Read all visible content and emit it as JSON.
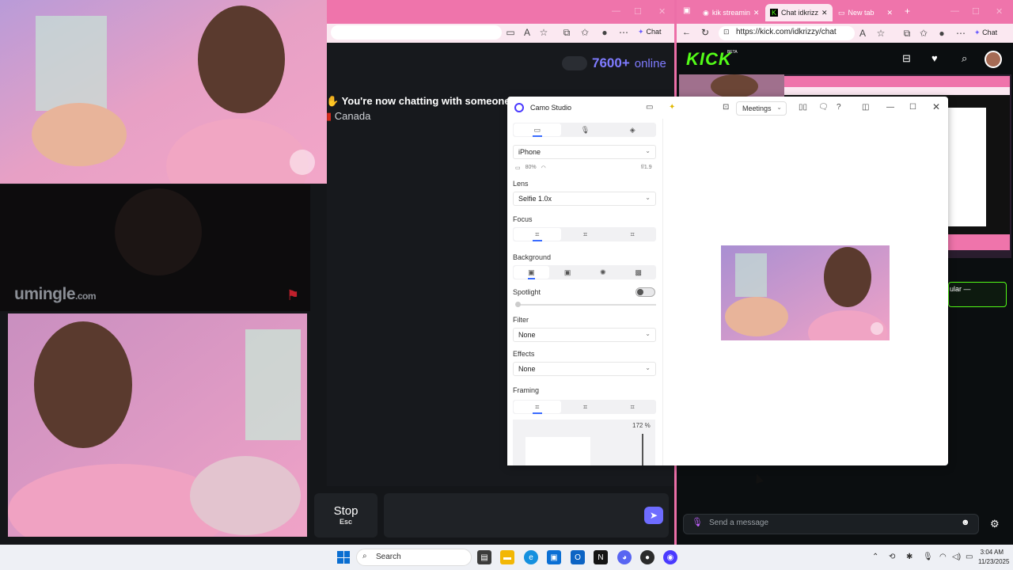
{
  "left_browser": {
    "online_count": "7600+",
    "online_word": "online",
    "chat_message": "You're now chatting with someone r",
    "country": "Canada",
    "logo_main": "umingle",
    "logo_suffix": ".com",
    "stop_label": "Stop",
    "stop_key": "Esc",
    "chat_button_label": "Chat"
  },
  "right_browser": {
    "tabs": [
      {
        "label": "kik streamin"
      },
      {
        "label": "Chat idkrizz"
      },
      {
        "label": "New tab"
      }
    ],
    "url": "https://kick.com/idkrizzy/chat",
    "chat_button_label": "Chat",
    "kick_logo": "KICK",
    "kick_beta": "BETA",
    "overlay_text": "ular —",
    "send_placeholder": "Send a message"
  },
  "camo_studio": {
    "title": "Camo Studio",
    "meetings_label": "Meetings",
    "device": "iPhone",
    "battery": "80%",
    "aperture": "f/1.9",
    "lens_label": "Lens",
    "lens_value": "Selfie 1.0x",
    "focus_label": "Focus",
    "background_label": "Background",
    "spotlight_label": "Spotlight",
    "filter_label": "Filter",
    "filter_value": "None",
    "effects_label": "Effects",
    "effects_value": "None",
    "framing_label": "Framing",
    "zoom_value": "172 %"
  },
  "taskbar": {
    "search_placeholder": "Search",
    "time": "3:04 AM",
    "date": "11/23/2025"
  },
  "colors": {
    "accent_pink": "#ec6fa8",
    "kick_green": "#53fc18",
    "umingle_accent": "#7f7bff",
    "camo_blue": "#3a6cff"
  }
}
